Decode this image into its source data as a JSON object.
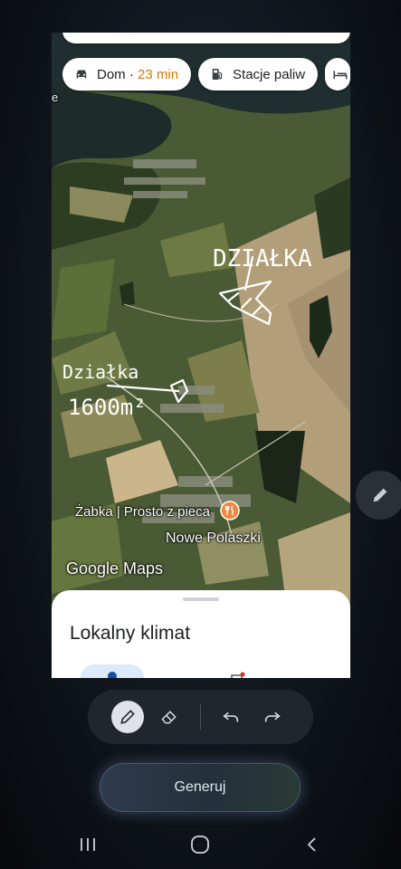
{
  "map": {
    "chips": [
      {
        "icon": "car-icon",
        "label": "Dom",
        "separator": "·",
        "time": "23 min"
      },
      {
        "icon": "gas-station-icon",
        "label": "Stacje paliw"
      },
      {
        "icon": "hotel-icon",
        "label": ""
      }
    ],
    "places": [
      {
        "name": "Żabka | Prosto z pieca"
      },
      {
        "name": "Nowe Polaszki"
      }
    ],
    "logo": "Google Maps",
    "edge_letter": "e",
    "annotations": {
      "plot1": "DZIAŁKA",
      "plot2_line1": "Działka",
      "plot2_line2": "1600m²"
    }
  },
  "sheet": {
    "title": "Lokalny klimat"
  },
  "toolbar": {
    "tools": [
      "pen-icon",
      "eraser-icon",
      "undo-icon",
      "redo-icon"
    ],
    "active": "pen-icon"
  },
  "generate": {
    "label": "Generuj"
  },
  "colors": {
    "time": "#e37400",
    "poi": "#f0883e",
    "accent": "#dcebfb"
  }
}
